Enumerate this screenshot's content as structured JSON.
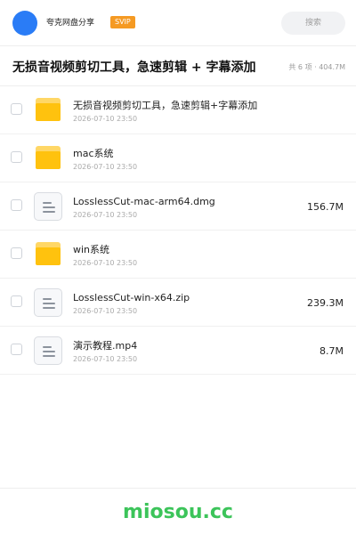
{
  "header": {
    "app_name": "夸克网盘分享",
    "badge": "SVIP",
    "search_placeholder": "搜索"
  },
  "share": {
    "title": "无损音视频剪切工具，急速剪辑 + 字幕添加",
    "meta": "共 6 项 · 404.7M"
  },
  "files": [
    {
      "type": "folder",
      "icon": "folder-icon",
      "name": "无损音视频剪切工具，急速剪辑+字幕添加",
      "date": "2026-07-10 23:50",
      "size": ""
    },
    {
      "type": "folder",
      "icon": "folder-icon",
      "name": "mac系统",
      "date": "2026-07-10 23:50",
      "size": ""
    },
    {
      "type": "file",
      "icon": "document-icon",
      "name": "LosslessCut-mac-arm64.dmg",
      "date": "2026-07-10 23:50",
      "size": "156.7M"
    },
    {
      "type": "folder",
      "icon": "folder-icon",
      "name": "win系统",
      "date": "2026-07-10 23:50",
      "size": ""
    },
    {
      "type": "file",
      "icon": "document-icon",
      "name": "LosslessCut-win-x64.zip",
      "date": "2026-07-10 23:50",
      "size": "239.3M"
    },
    {
      "type": "file",
      "icon": "document-icon",
      "name": "演示教程.mp4",
      "date": "2026-07-10 23:50",
      "size": "8.7M"
    }
  ],
  "footer": {
    "watermark": "miosou.cc"
  },
  "colors": {
    "avatar": "#2a7cf6",
    "badge": "#f59a23",
    "folder": "#ffc20e",
    "watermark": "#3cc45a"
  }
}
